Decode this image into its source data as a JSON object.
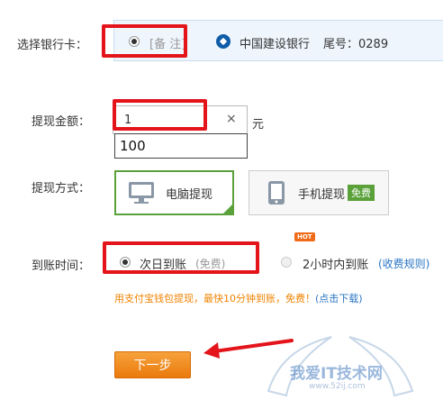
{
  "bank_card": {
    "label": "选择银行卡：",
    "remark": "[备 注]",
    "bank_name": "中国建设银行",
    "tail_number": "尾号：0289"
  },
  "amount": {
    "label": "提现金额：",
    "value": "1",
    "clear_symbol": "×",
    "unit": "元",
    "suggestion": "100"
  },
  "method": {
    "label": "提现方式：",
    "pc_label": "电脑提现",
    "mobile_label": "手机提现",
    "free_badge": "免费"
  },
  "arrival": {
    "label": "到账时间：",
    "next_day": "次日到账",
    "next_day_note": "(免费)",
    "hot_badge": "HOT",
    "fast": "2小时内到账",
    "fee_rules": "(收费规则)"
  },
  "promo": {
    "text": "用支付宝钱包提现，最快10分钟到账，免费！",
    "link": "(点击下载)"
  },
  "next_button": "下一步",
  "watermark": {
    "title": "我爱IT技术网",
    "url": "www.52ij.com"
  },
  "colors": {
    "highlight_red": "#e4141b",
    "accent_green": "#5aa13a",
    "link_blue": "#2a74c4",
    "promo_orange": "#f08300",
    "button_orange": "#ea7a0d"
  }
}
